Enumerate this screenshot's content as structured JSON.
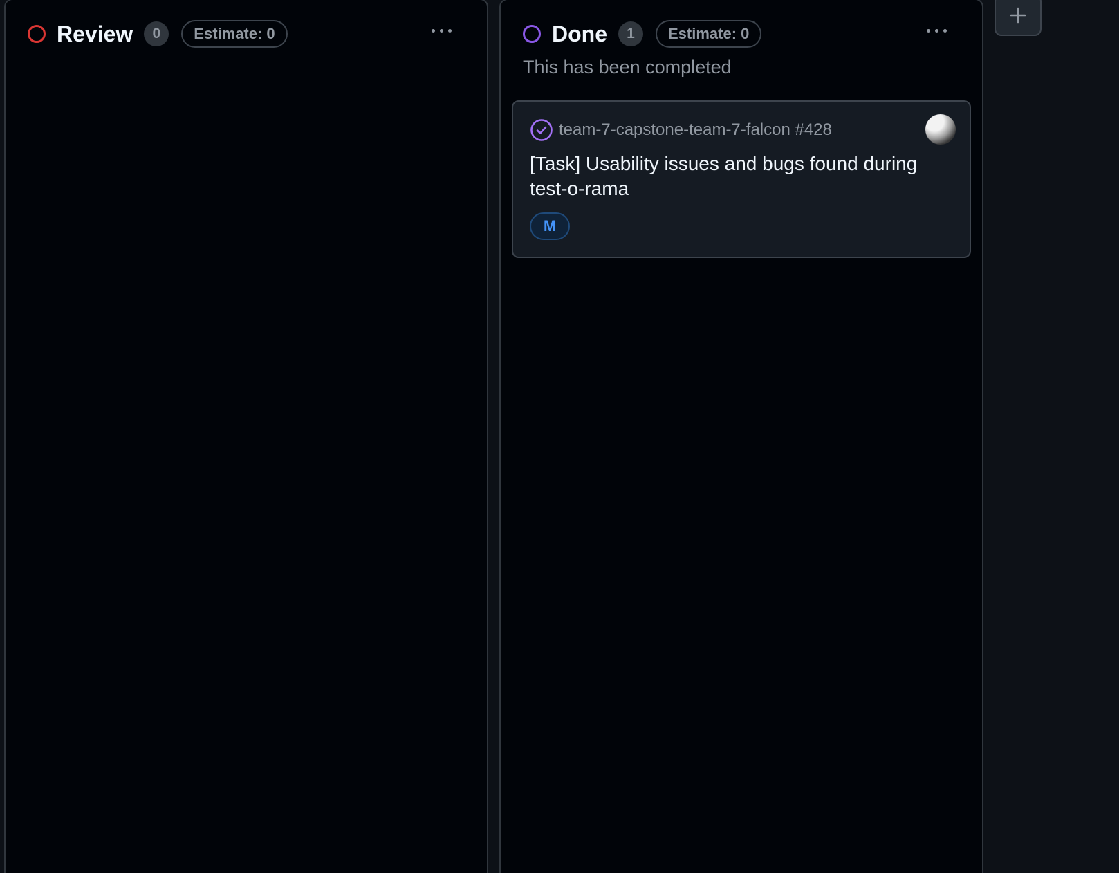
{
  "columns": [
    {
      "title": "Review",
      "count": "0",
      "estimate": "Estimate: 0",
      "status_color": "#da3633",
      "status_icon": "circle-outline-icon",
      "menu_icon": "kebab-horizontal-icon"
    },
    {
      "title": "Done",
      "count": "1",
      "estimate": "Estimate: 0",
      "description": "This has been completed",
      "status_color": "#8957e5",
      "status_icon": "circle-outline-icon",
      "menu_icon": "kebab-horizontal-icon",
      "cards": [
        {
          "repo": "team-7-capstone-team-7-falcon #428",
          "title": "[Task] Usability issues and bugs found during test-o-rama",
          "size": "M",
          "state_icon": "issue-closed-check-icon",
          "state_color": "#a371f7",
          "assignee_icon": "avatar"
        }
      ]
    }
  ],
  "toolbar": {
    "add_column_icon": "plus-icon"
  }
}
